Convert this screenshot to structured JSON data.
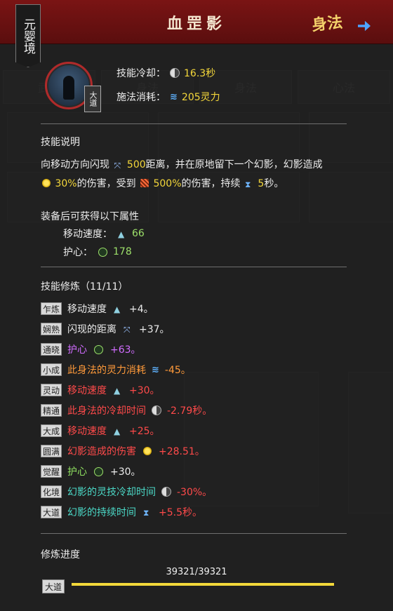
{
  "header": {
    "title": "血罡影",
    "realm": "元婴境",
    "skill_type": "身法",
    "avatar_tag": "大道"
  },
  "stats": {
    "cooldown_label": "技能冷却：",
    "cooldown_value": "16.3秒",
    "cost_label": "施法消耗：",
    "cost_value": "205灵力"
  },
  "description": {
    "title": "技能说明",
    "line1_pre": "向移动方向闪现",
    "line1_dist": "500",
    "line1_post": "距离，并在原地留下一个幻影，幻影造成",
    "line2_pct1": "30%",
    "line2_mid1": "的伤害，受到",
    "line2_pct2": "500%",
    "line2_mid2": "的伤害，持续",
    "line2_dur": "5",
    "line2_post": "秒。"
  },
  "attributes": {
    "title": "装备后可获得以下属性",
    "items": [
      {
        "label": "移动速度：",
        "value": "66"
      },
      {
        "label": "护心：",
        "value": "178"
      }
    ]
  },
  "cultivation": {
    "title": "技能修炼（11/11）",
    "rows": [
      {
        "tag": "乍炼",
        "text": "移动速度",
        "value": "+4。"
      },
      {
        "tag": "娴熟",
        "text": "闪现的距离",
        "value": "+37。"
      },
      {
        "tag": "通晓",
        "text": "护心",
        "value": "+63。"
      },
      {
        "tag": "小成",
        "text": "此身法的灵力消耗",
        "value": "-45。"
      },
      {
        "tag": "灵动",
        "text": "移动速度",
        "value": "+30。"
      },
      {
        "tag": "精通",
        "text": "此身法的冷却时间",
        "value": "-2.79秒。"
      },
      {
        "tag": "大成",
        "text": "移动速度",
        "value": "+25。"
      },
      {
        "tag": "圆满",
        "text": "幻影造成的伤害",
        "value": "+28.51。"
      },
      {
        "tag": "觉醒",
        "text": "护心",
        "value": "+30。"
      },
      {
        "tag": "化境",
        "text": "幻影的灵技冷却时间",
        "value": "-30%。"
      },
      {
        "tag": "大道",
        "text": "幻影的持续时间",
        "value": "+5.5秒。"
      }
    ]
  },
  "progress": {
    "label": "修炼进度",
    "text": "39321/39321",
    "tag": "大道",
    "fraction": 1.0
  },
  "background": {
    "tabs": [
      "武技",
      "身法",
      "身法",
      "心法"
    ]
  }
}
